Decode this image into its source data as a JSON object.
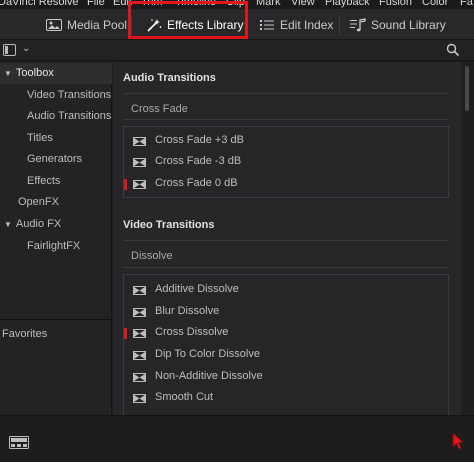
{
  "menubar": {
    "items": [
      "DaVinci Resolve",
      "File",
      "Edit",
      "Trim",
      "Timeline",
      "Clip",
      "Mark",
      "View",
      "Playback",
      "Fusion",
      "Color",
      "Fa"
    ]
  },
  "toolbar": {
    "media_pool": "Media Pool",
    "effects_library": "Effects Library",
    "edit_index": "Edit Index",
    "sound_library": "Sound Library"
  },
  "sidebar": {
    "toolbox": "Toolbox",
    "items": [
      "Video Transitions",
      "Audio Transitions",
      "Titles",
      "Generators",
      "Effects"
    ],
    "openfx": "OpenFX",
    "audio_fx": "Audio FX",
    "fairlight_fx": "FairlightFX",
    "favorites": "Favorites"
  },
  "content": {
    "audio_transitions": {
      "title": "Audio Transitions",
      "group": "Cross Fade",
      "items": [
        "Cross Fade +3 dB",
        "Cross Fade -3 dB",
        "Cross Fade 0 dB"
      ]
    },
    "video_transitions": {
      "title": "Video Transitions",
      "group": "Dissolve",
      "items": [
        "Additive Dissolve",
        "Blur Dissolve",
        "Cross Dissolve",
        "Dip To Color Dissolve",
        "Non-Additive Dissolve",
        "Smooth Cut"
      ]
    }
  },
  "colors": {
    "highlight": "#e0161b",
    "marker": "#e0161b",
    "background": "#27272a"
  }
}
